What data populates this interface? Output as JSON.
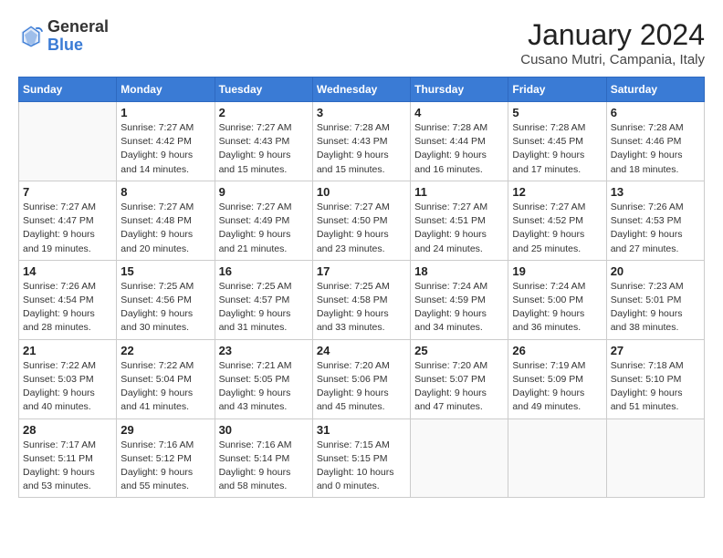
{
  "header": {
    "logo_general": "General",
    "logo_blue": "Blue",
    "month_title": "January 2024",
    "location": "Cusano Mutri, Campania, Italy"
  },
  "weekdays": [
    "Sunday",
    "Monday",
    "Tuesday",
    "Wednesday",
    "Thursday",
    "Friday",
    "Saturday"
  ],
  "weeks": [
    [
      {
        "day": "",
        "info": ""
      },
      {
        "day": "1",
        "info": "Sunrise: 7:27 AM\nSunset: 4:42 PM\nDaylight: 9 hours\nand 14 minutes."
      },
      {
        "day": "2",
        "info": "Sunrise: 7:27 AM\nSunset: 4:43 PM\nDaylight: 9 hours\nand 15 minutes."
      },
      {
        "day": "3",
        "info": "Sunrise: 7:28 AM\nSunset: 4:43 PM\nDaylight: 9 hours\nand 15 minutes."
      },
      {
        "day": "4",
        "info": "Sunrise: 7:28 AM\nSunset: 4:44 PM\nDaylight: 9 hours\nand 16 minutes."
      },
      {
        "day": "5",
        "info": "Sunrise: 7:28 AM\nSunset: 4:45 PM\nDaylight: 9 hours\nand 17 minutes."
      },
      {
        "day": "6",
        "info": "Sunrise: 7:28 AM\nSunset: 4:46 PM\nDaylight: 9 hours\nand 18 minutes."
      }
    ],
    [
      {
        "day": "7",
        "info": "Sunrise: 7:27 AM\nSunset: 4:47 PM\nDaylight: 9 hours\nand 19 minutes."
      },
      {
        "day": "8",
        "info": "Sunrise: 7:27 AM\nSunset: 4:48 PM\nDaylight: 9 hours\nand 20 minutes."
      },
      {
        "day": "9",
        "info": "Sunrise: 7:27 AM\nSunset: 4:49 PM\nDaylight: 9 hours\nand 21 minutes."
      },
      {
        "day": "10",
        "info": "Sunrise: 7:27 AM\nSunset: 4:50 PM\nDaylight: 9 hours\nand 23 minutes."
      },
      {
        "day": "11",
        "info": "Sunrise: 7:27 AM\nSunset: 4:51 PM\nDaylight: 9 hours\nand 24 minutes."
      },
      {
        "day": "12",
        "info": "Sunrise: 7:27 AM\nSunset: 4:52 PM\nDaylight: 9 hours\nand 25 minutes."
      },
      {
        "day": "13",
        "info": "Sunrise: 7:26 AM\nSunset: 4:53 PM\nDaylight: 9 hours\nand 27 minutes."
      }
    ],
    [
      {
        "day": "14",
        "info": "Sunrise: 7:26 AM\nSunset: 4:54 PM\nDaylight: 9 hours\nand 28 minutes."
      },
      {
        "day": "15",
        "info": "Sunrise: 7:25 AM\nSunset: 4:56 PM\nDaylight: 9 hours\nand 30 minutes."
      },
      {
        "day": "16",
        "info": "Sunrise: 7:25 AM\nSunset: 4:57 PM\nDaylight: 9 hours\nand 31 minutes."
      },
      {
        "day": "17",
        "info": "Sunrise: 7:25 AM\nSunset: 4:58 PM\nDaylight: 9 hours\nand 33 minutes."
      },
      {
        "day": "18",
        "info": "Sunrise: 7:24 AM\nSunset: 4:59 PM\nDaylight: 9 hours\nand 34 minutes."
      },
      {
        "day": "19",
        "info": "Sunrise: 7:24 AM\nSunset: 5:00 PM\nDaylight: 9 hours\nand 36 minutes."
      },
      {
        "day": "20",
        "info": "Sunrise: 7:23 AM\nSunset: 5:01 PM\nDaylight: 9 hours\nand 38 minutes."
      }
    ],
    [
      {
        "day": "21",
        "info": "Sunrise: 7:22 AM\nSunset: 5:03 PM\nDaylight: 9 hours\nand 40 minutes."
      },
      {
        "day": "22",
        "info": "Sunrise: 7:22 AM\nSunset: 5:04 PM\nDaylight: 9 hours\nand 41 minutes."
      },
      {
        "day": "23",
        "info": "Sunrise: 7:21 AM\nSunset: 5:05 PM\nDaylight: 9 hours\nand 43 minutes."
      },
      {
        "day": "24",
        "info": "Sunrise: 7:20 AM\nSunset: 5:06 PM\nDaylight: 9 hours\nand 45 minutes."
      },
      {
        "day": "25",
        "info": "Sunrise: 7:20 AM\nSunset: 5:07 PM\nDaylight: 9 hours\nand 47 minutes."
      },
      {
        "day": "26",
        "info": "Sunrise: 7:19 AM\nSunset: 5:09 PM\nDaylight: 9 hours\nand 49 minutes."
      },
      {
        "day": "27",
        "info": "Sunrise: 7:18 AM\nSunset: 5:10 PM\nDaylight: 9 hours\nand 51 minutes."
      }
    ],
    [
      {
        "day": "28",
        "info": "Sunrise: 7:17 AM\nSunset: 5:11 PM\nDaylight: 9 hours\nand 53 minutes."
      },
      {
        "day": "29",
        "info": "Sunrise: 7:16 AM\nSunset: 5:12 PM\nDaylight: 9 hours\nand 55 minutes."
      },
      {
        "day": "30",
        "info": "Sunrise: 7:16 AM\nSunset: 5:14 PM\nDaylight: 9 hours\nand 58 minutes."
      },
      {
        "day": "31",
        "info": "Sunrise: 7:15 AM\nSunset: 5:15 PM\nDaylight: 10 hours\nand 0 minutes."
      },
      {
        "day": "",
        "info": ""
      },
      {
        "day": "",
        "info": ""
      },
      {
        "day": "",
        "info": ""
      }
    ]
  ]
}
